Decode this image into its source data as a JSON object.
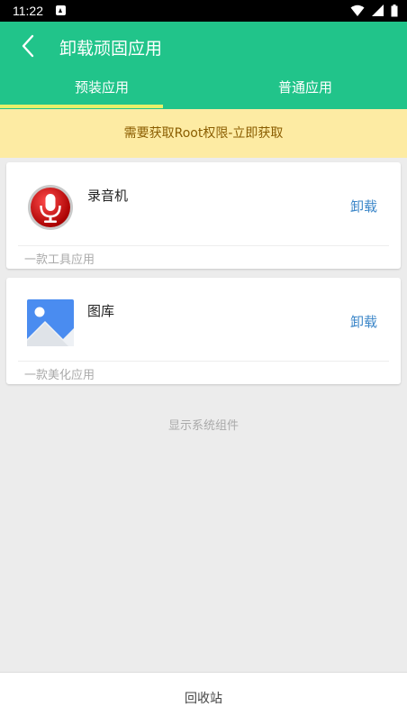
{
  "status_bar": {
    "time": "11:22",
    "notification_icon": "a-notification-icon",
    "icons": [
      "wifi-icon",
      "signal-icon",
      "battery-icon"
    ]
  },
  "app_bar": {
    "title": "卸载顽固应用",
    "back_icon": "back-arrow-icon",
    "color": "#21c48a",
    "tabs": [
      {
        "label": "预装应用",
        "selected": true
      },
      {
        "label": "普通应用",
        "selected": false
      }
    ],
    "indicator_color": "#e7f06a"
  },
  "banner": {
    "text": "需要获取Root权限-立即获取",
    "color": "#fdeba3"
  },
  "apps": [
    {
      "name": "录音机",
      "description": "一款工具应用",
      "action": "卸载",
      "icon": "microphone-icon"
    },
    {
      "name": "图库",
      "description": "一款美化应用",
      "action": "卸载",
      "icon": "gallery-icon"
    }
  ],
  "show_system_label": "显示系统组件",
  "bottom": {
    "recycle_label": "回收站"
  },
  "colors": {
    "accent": "#3b86c8"
  }
}
